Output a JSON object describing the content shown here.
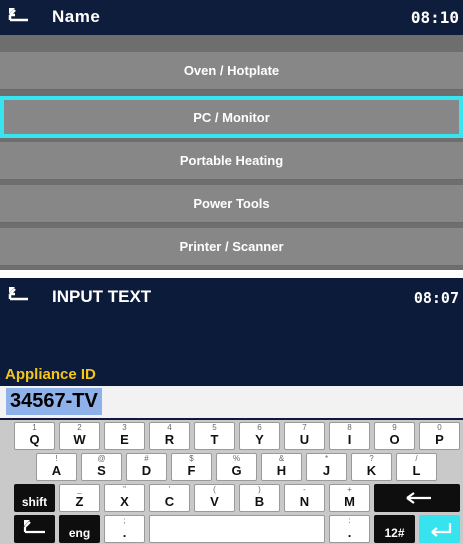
{
  "screen1": {
    "title": "Name",
    "time": "08:10",
    "back_icon": "back-arrow-icon",
    "items": [
      {
        "label": "Oven / Hotplate",
        "selected": false
      },
      {
        "label": "PC / Monitor",
        "selected": true
      },
      {
        "label": "Portable Heating",
        "selected": false
      },
      {
        "label": "Power Tools",
        "selected": false
      },
      {
        "label": "Printer / Scanner",
        "selected": false
      }
    ],
    "selection_color": "#37e4f0"
  },
  "screen2": {
    "title": "INPUT TEXT",
    "time": "08:07",
    "back_icon": "back-arrow-icon",
    "field_label": "Appliance ID",
    "field_value": "34567-TV",
    "keyboard": {
      "row1": [
        {
          "main": "Q",
          "sub": "1"
        },
        {
          "main": "W",
          "sub": "2"
        },
        {
          "main": "E",
          "sub": "3"
        },
        {
          "main": "R",
          "sub": "4"
        },
        {
          "main": "T",
          "sub": "5"
        },
        {
          "main": "Y",
          "sub": "6"
        },
        {
          "main": "U",
          "sub": "7"
        },
        {
          "main": "I",
          "sub": "8"
        },
        {
          "main": "O",
          "sub": "9"
        },
        {
          "main": "P",
          "sub": "0"
        }
      ],
      "row2": [
        {
          "main": "A",
          "sub": "!"
        },
        {
          "main": "S",
          "sub": "@"
        },
        {
          "main": "D",
          "sub": "#"
        },
        {
          "main": "F",
          "sub": "$"
        },
        {
          "main": "G",
          "sub": "%"
        },
        {
          "main": "H",
          "sub": "&"
        },
        {
          "main": "J",
          "sub": "*"
        },
        {
          "main": "K",
          "sub": "?"
        },
        {
          "main": "L",
          "sub": "/"
        }
      ],
      "row3": [
        {
          "main": "Z",
          "sub": "_"
        },
        {
          "main": "X",
          "sub": "\""
        },
        {
          "main": "C",
          "sub": "'"
        },
        {
          "main": "V",
          "sub": "("
        },
        {
          "main": "B",
          "sub": ")"
        },
        {
          "main": "N",
          "sub": "-"
        },
        {
          "main": "M",
          "sub": "+"
        }
      ],
      "shift_label": "shift",
      "backspace_icon": "backspace-arrow-icon",
      "row4": {
        "lang_label": "eng",
        "punct1": {
          "main": ".",
          "sub": ";"
        },
        "punct2": {
          "main": ".",
          "sub": ":"
        },
        "mode_label": "12#",
        "enter_icon": "enter-icon",
        "back_icon": "back-arrow-icon"
      }
    }
  }
}
